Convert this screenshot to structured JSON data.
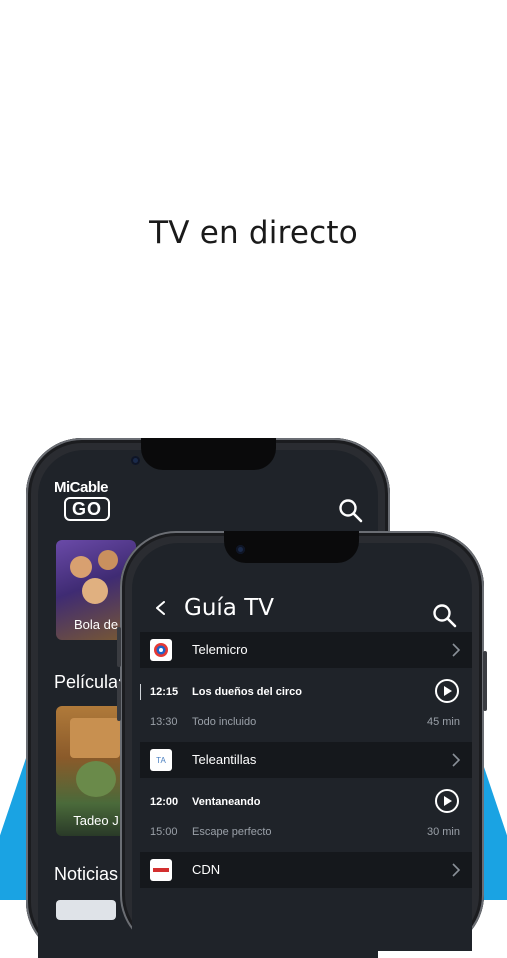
{
  "headline": "TV en directo",
  "back_phone": {
    "logo_line1": "MiCable",
    "logo_line2": "GO",
    "featured_label": "Bola de",
    "section_movies": "Películas",
    "movie_label": "Tadeo J",
    "section_news": "Noticias"
  },
  "guide": {
    "title": "Guía TV",
    "channels": [
      {
        "name": "Telemicro",
        "now": {
          "time": "12:15",
          "title": "Los dueños del circo"
        },
        "next": {
          "time": "13:30",
          "title": "Todo incluido"
        },
        "duration": "45 min"
      },
      {
        "name": "Teleantillas",
        "now": {
          "time": "12:00",
          "title": "Ventaneando"
        },
        "next": {
          "time": "15:00",
          "title": "Escape perfecto"
        },
        "duration": "30 min"
      },
      {
        "name": "CDN"
      }
    ]
  },
  "colors": {
    "accent_blue": "#1aa3e3",
    "screen_bg": "#1f2329",
    "row_bg": "#15181c"
  }
}
